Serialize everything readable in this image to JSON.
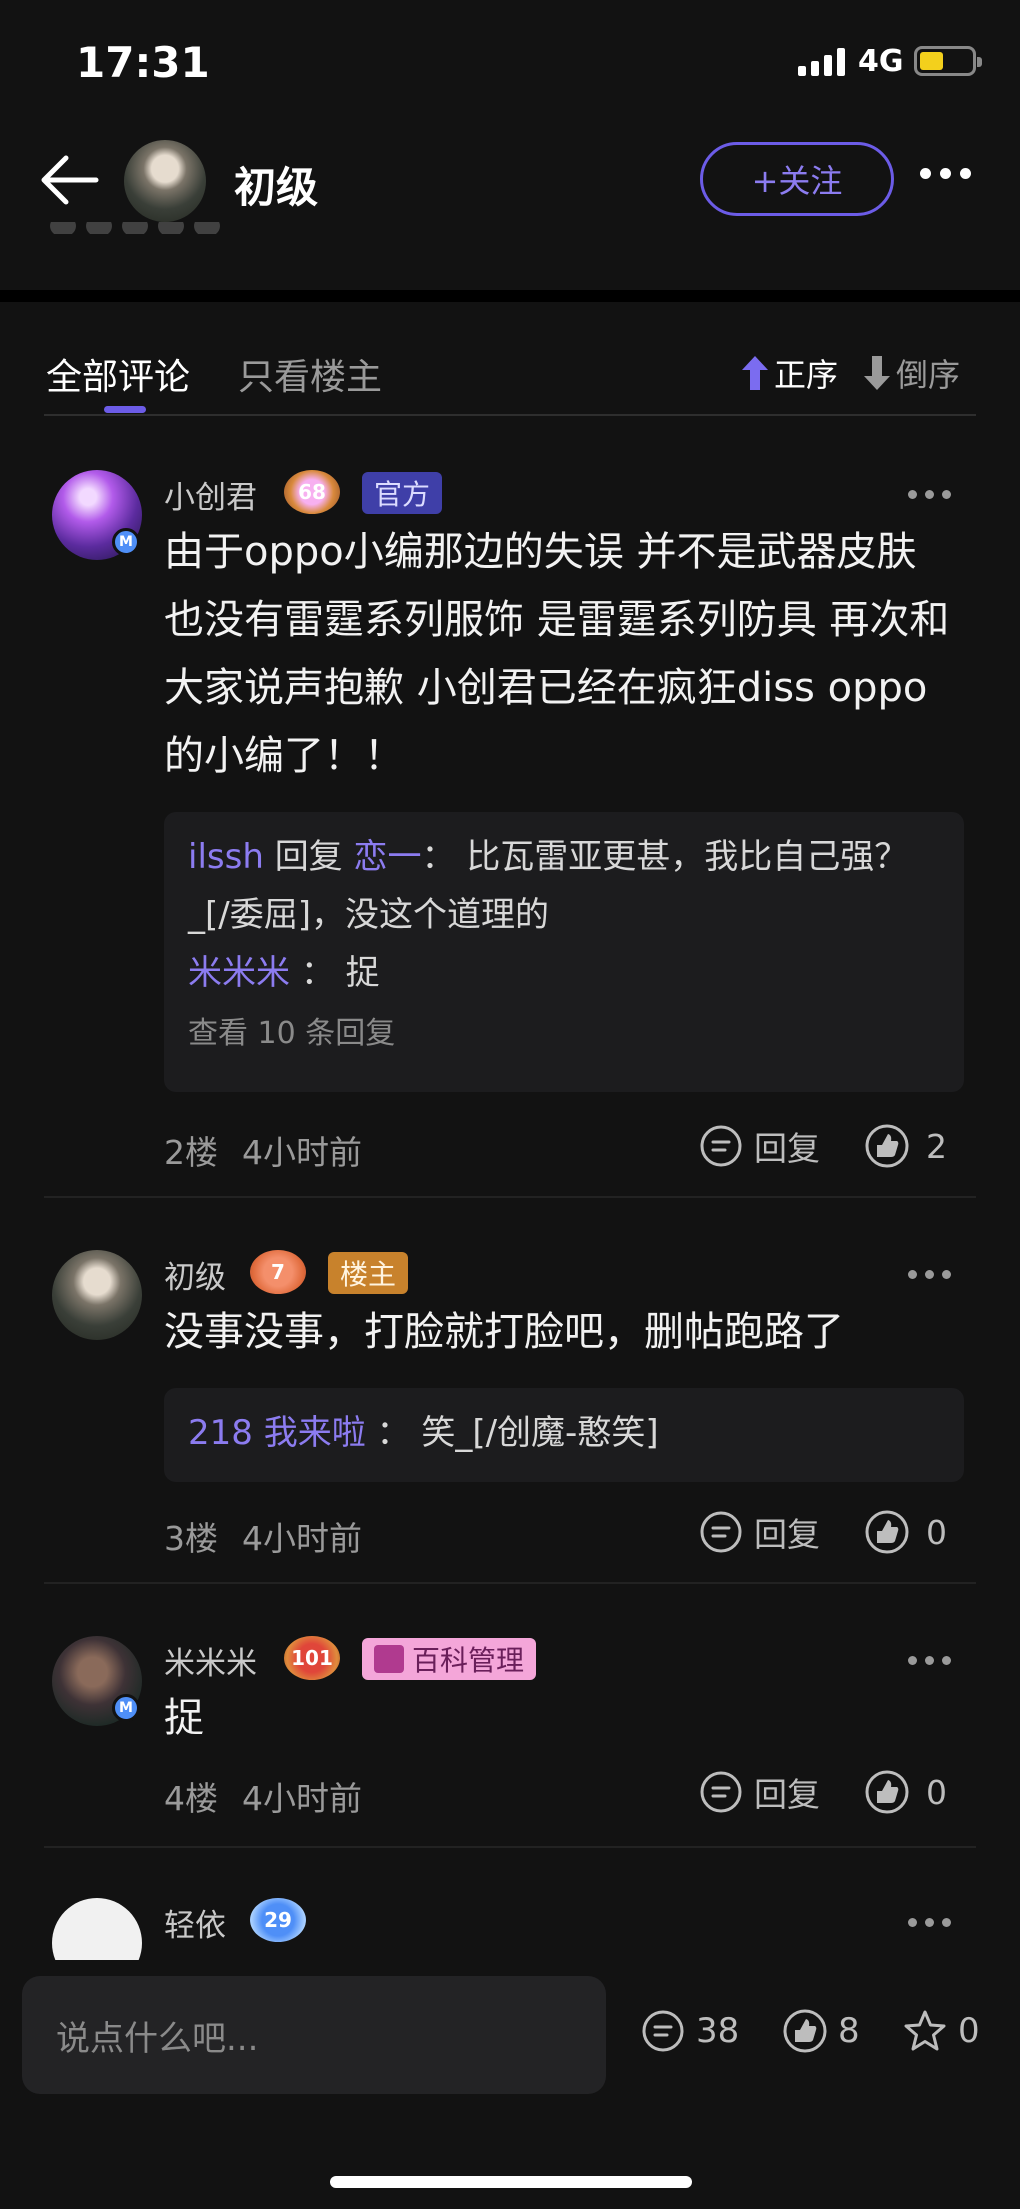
{
  "status": {
    "time": "17:31",
    "network": "4G",
    "battery_level": 0.45
  },
  "header": {
    "name": "初级",
    "follow_label": "+关注"
  },
  "tabs": {
    "all": "全部评论",
    "owner_only": "只看楼主",
    "asc": "正序",
    "desc": "倒序"
  },
  "comments": [
    {
      "name": "小创君",
      "level": "68",
      "tag": "官方",
      "text": "由于oppo小编那边的失误 并不是武器皮肤 也没有雷霆系列服饰 是雷霆系列防具 再次和大家说声抱歉 小创君已经在疯狂diss oppo的小编了！！",
      "replies": [
        {
          "user": "ilssh",
          "reply_word": "回复",
          "target": "恋一",
          "sep": "：",
          "content": "比瓦雷亚更甚，我比自己强？_[/委屈]，没这个道理的"
        },
        {
          "user": "米米米",
          "sep": "：",
          "content": "捉"
        }
      ],
      "more_replies": "查看 10 条回复",
      "floor": "2楼",
      "time": "4小时前",
      "reply_label": "回复",
      "likes": "2"
    },
    {
      "name": "初级",
      "level": "7",
      "tag": "楼主",
      "text": "没事没事，打脸就打脸吧，删帖跑路了",
      "replies": [
        {
          "user": "218 我来啦",
          "sep": "：",
          "content": "笑_[/创魔-憨笑]"
        }
      ],
      "floor": "3楼",
      "time": "4小时前",
      "reply_label": "回复",
      "likes": "0"
    },
    {
      "name": "米米米",
      "level": "101",
      "tag": "百科管理",
      "text": "捉",
      "floor": "4楼",
      "time": "4小时前",
      "reply_label": "回复",
      "likes": "0"
    },
    {
      "name": "轻依",
      "level": "29"
    }
  ],
  "bottom": {
    "placeholder": "说点什么吧...",
    "comments": "38",
    "likes": "8",
    "favorites": "0"
  },
  "colors": {
    "accent": "#6c5ce7",
    "official_tag": "#4b4bb5",
    "owner_tag": "#c8822c",
    "wiki_tag": "#f4a6d9"
  },
  "icons": [
    "back-arrow-icon",
    "more-icon",
    "arrow-up-icon",
    "arrow-down-icon",
    "comment-icon",
    "thumb-icon",
    "star-icon"
  ]
}
